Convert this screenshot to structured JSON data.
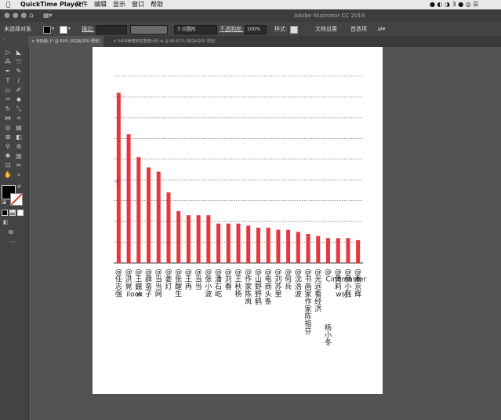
{
  "menubar": {
    "app_name": "QuickTime Player",
    "items": [
      "文件",
      "编辑",
      "显示",
      "窗口",
      "帮助"
    ],
    "status_number": "3"
  },
  "appbar": {
    "title": "Adobe Illustrator CC 2019"
  },
  "control": {
    "selection": "未选择对象",
    "stroke_label": "描边:",
    "brush": "3 点圆形",
    "opacity_label": "不透明度:",
    "opacity_value": "100%",
    "style_label": "样式:",
    "doc_setup": "文档设置",
    "prefs": "首选项"
  },
  "tabs": [
    "未标题-1* @ 50% (RGB/GPU 预览)",
    "0406微博转发数据分析.ai @ 66.67% (RGB/GPU 预览)"
  ],
  "colors": {
    "bar": "#e8363d",
    "axis": "#333333",
    "grid": "#555555"
  },
  "chart_data": {
    "type": "bar",
    "categories": [
      "@任志强",
      "@洪晃ilook",
      "@王巍w",
      "@薛蛮子",
      "@当当网",
      "@姜灯",
      "@张醒生",
      "@王冉",
      "@当当",
      "@张小波",
      "@潘石屹",
      "@刘春",
      "@王秋杨",
      "@作家陈岚",
      "@山野野鹤",
      "@电商头条",
      "@刘苏里",
      "@何兵",
      "@沈浩波",
      "@书画家作家陈祖芬",
      "@光远看经济",
      "@Cinemaster杨小冬",
      "@黄莉wsj",
      "@侯小强",
      "@秦京辉"
    ],
    "values": [
      82,
      62,
      51,
      46,
      44,
      34,
      25,
      23,
      23,
      23,
      19,
      19,
      19,
      18,
      17,
      17,
      16,
      16,
      15,
      14,
      13,
      12,
      12,
      12,
      11
    ],
    "ylim": [
      0,
      90
    ],
    "grid": true
  }
}
